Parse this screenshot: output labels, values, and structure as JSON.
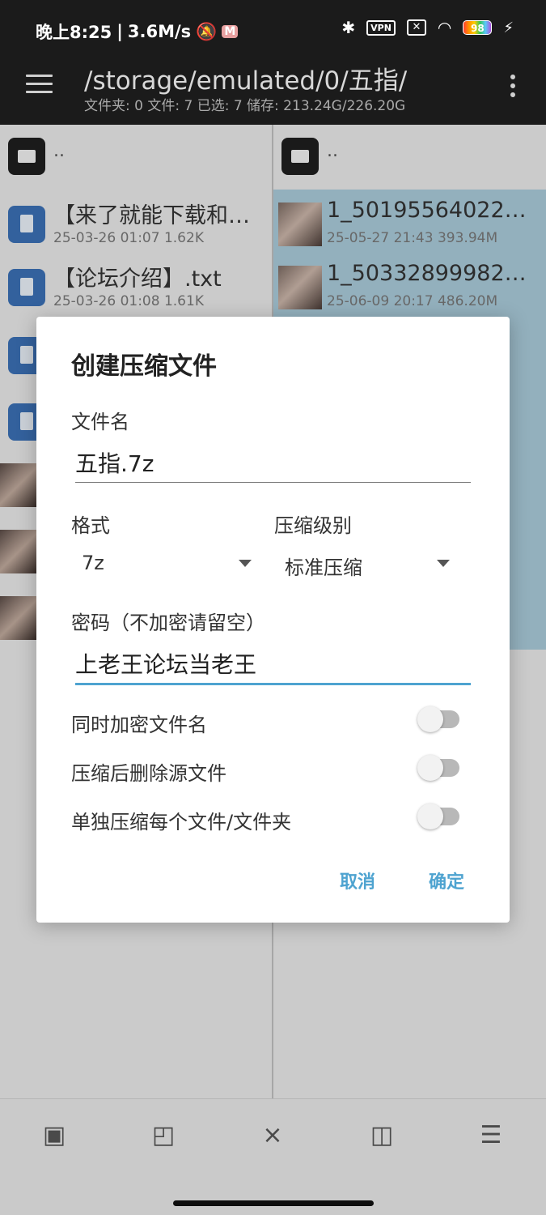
{
  "status_bar": {
    "time": "晚上8:25",
    "speed": "3.6M/s",
    "vpn": "VPN",
    "battery": "98"
  },
  "app_bar": {
    "path": "/storage/emulated/0/五指/",
    "stats": "文件夹: 0  文件: 7  已选: 7  储存: 213.24G/226.20G"
  },
  "left_pane": {
    "parent": "..",
    "files": [
      {
        "name": "【来了就能下载和…",
        "meta": "25-03-26 01:07  1.62K"
      },
      {
        "name": "【论坛介绍】.txt",
        "meta": "25-03-26 01:08  1.61K"
      }
    ]
  },
  "right_pane": {
    "parent": "..",
    "files": [
      {
        "name": "1_501955640228…",
        "meta": "25-05-27 21:43  393.94M"
      },
      {
        "name": "1_503328999829…",
        "meta": "25-06-09 20:17  486.20M"
      }
    ]
  },
  "dialog": {
    "title": "创建压缩文件",
    "filename_label": "文件名",
    "filename_value": "五指.7z",
    "format_label": "格式",
    "format_value": "7z",
    "level_label": "压缩级别",
    "level_value": "标准压缩",
    "password_label": "密码（不加密请留空）",
    "password_value": "上老王论坛当老王",
    "switches": [
      {
        "label": "同时加密文件名",
        "on": false
      },
      {
        "label": "压缩后删除源文件",
        "on": false
      },
      {
        "label": "单独压缩每个文件/文件夹",
        "on": false
      }
    ],
    "cancel": "取消",
    "ok": "确定"
  },
  "colors": {
    "accent": "#4ea3d0",
    "selection": "#a8c9d8",
    "bar": "#1b1b1b"
  }
}
